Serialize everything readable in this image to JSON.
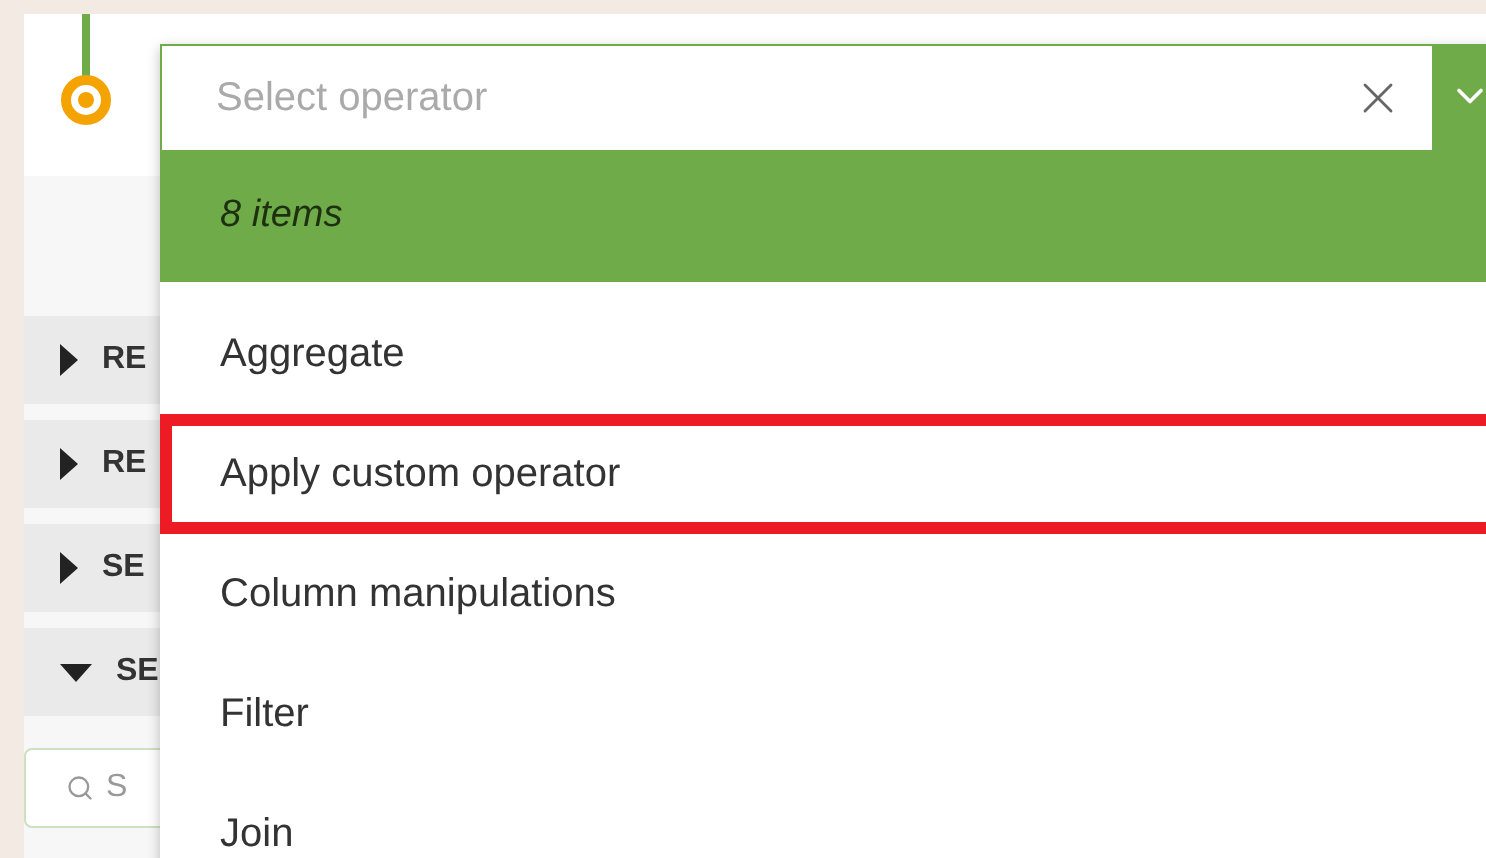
{
  "sections": [
    {
      "label": "RE",
      "expanded": false
    },
    {
      "label": "RE",
      "expanded": false
    },
    {
      "label": "SE",
      "expanded": false
    },
    {
      "label": "SE",
      "expanded": true
    }
  ],
  "sidebar_search": {
    "placeholder": "S"
  },
  "operator_select": {
    "placeholder": "Select operator",
    "count": "8 items",
    "items": [
      {
        "label": "Aggregate",
        "selected": false
      },
      {
        "label": "Apply custom operator",
        "selected": true
      },
      {
        "label": "Column manipulations",
        "selected": false
      },
      {
        "label": "Filter",
        "selected": false
      },
      {
        "label": "Join",
        "selected": false
      }
    ]
  }
}
